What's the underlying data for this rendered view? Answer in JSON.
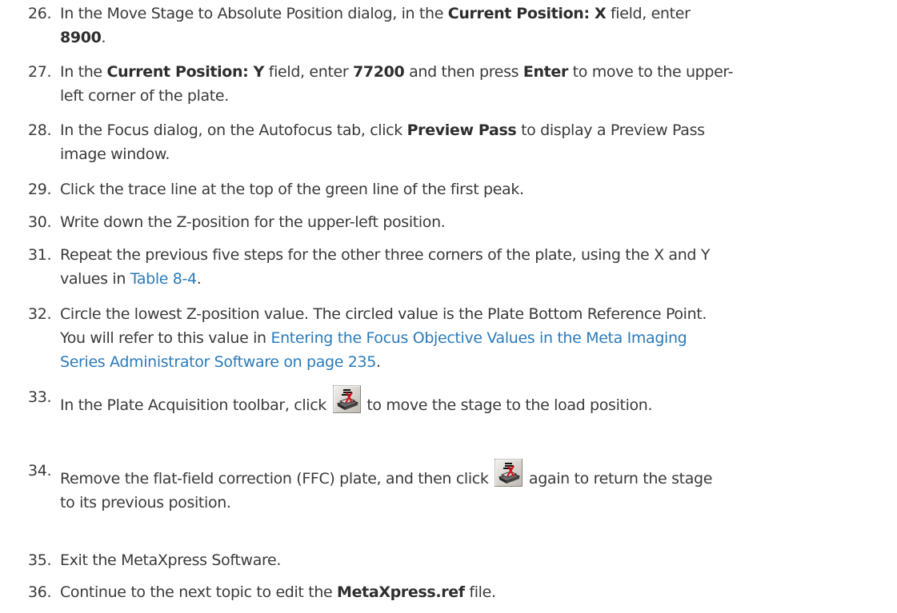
{
  "steps": [
    {
      "num": "26.",
      "t1": "In the Move Stage to Absolute Position dialog, in the ",
      "b1": "Current Position: X",
      "t2": " field, enter",
      "b2": "8900",
      "t3": "."
    },
    {
      "num": "27.",
      "t1": "In the ",
      "b1": "Current Position: Y",
      "t2": " field, enter ",
      "b2": "77200",
      "t3": " and then press ",
      "b3": "Enter",
      "t4": " to move to the upper-",
      "t5": "left corner of the plate."
    },
    {
      "num": "28.",
      "t1": "In the Focus dialog, on the Autofocus tab, click ",
      "b1": "Preview Pass",
      "t2": " to display a Preview Pass",
      "t3": "image window."
    },
    {
      "num": "29.",
      "t1": "Click the trace line at the top of the green line of the first peak."
    },
    {
      "num": "30.",
      "t1": "Write down the Z-position for the upper-left position."
    },
    {
      "num": "31.",
      "t1": "Repeat the previous five steps for the other three corners of the plate, using the X and Y",
      "t2": "values in ",
      "link": "Table 8-4",
      "t3": "."
    },
    {
      "num": "32.",
      "t1": "Circle the lowest Z-position value. The circled value is the Plate Bottom Reference Point.",
      "t2": "You will refer to this value in ",
      "link1": "Entering the Focus Objective Values in the Meta Imaging",
      "link2": "Series Administrator Software on page 235",
      "t3": "."
    },
    {
      "num": "33.",
      "t1": "In the Plate Acquisition toolbar, click ",
      "t2": " to move the stage to the load position."
    },
    {
      "num": "34.",
      "t1": "Remove the flat-field correction (FFC) plate, and then click ",
      "t2": " again to return the stage",
      "t3": "to its previous position."
    },
    {
      "num": "35.",
      "t1": "Exit the MetaXpress Software."
    },
    {
      "num": "36.",
      "t1": "Continue to the next topic to edit the ",
      "b1": "MetaXpress.ref",
      "t2": " file."
    }
  ],
  "icons": {
    "load_position": "stage-load-position-icon"
  },
  "colors": {
    "link": "#2b7bb9",
    "text": "#3a3a3a"
  }
}
